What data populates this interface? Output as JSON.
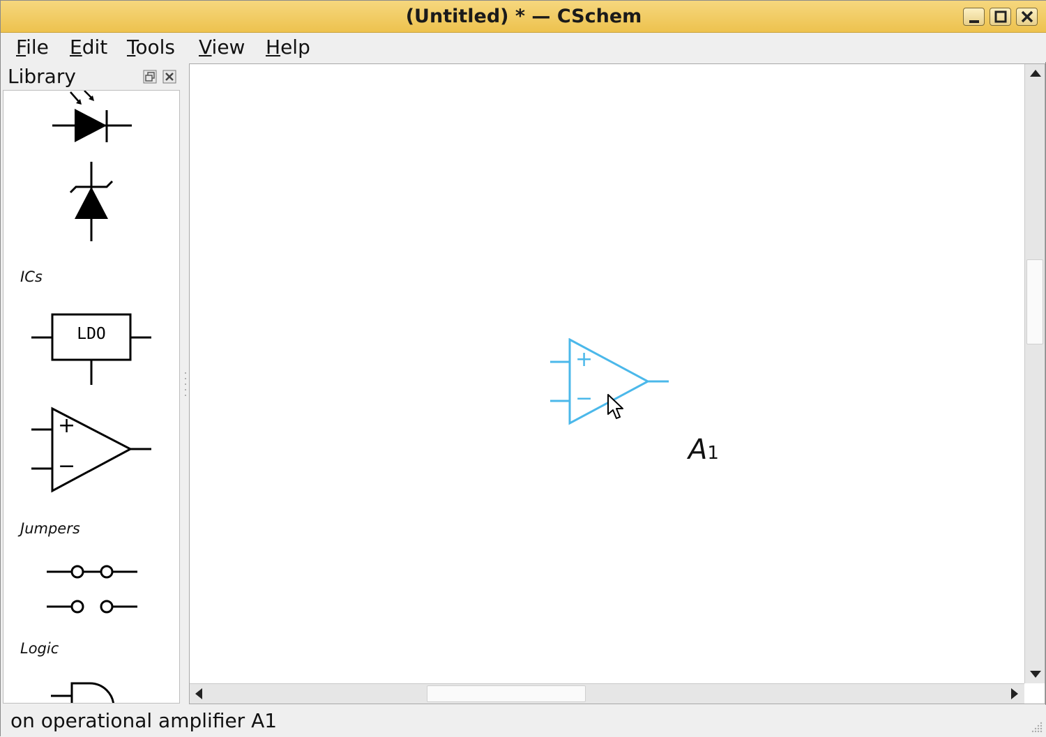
{
  "window": {
    "title": "(Untitled) * — CSchem"
  },
  "menu": [
    {
      "mnemonic": "F",
      "rest": "ile"
    },
    {
      "mnemonic": "E",
      "rest": "dit"
    },
    {
      "mnemonic": "T",
      "rest": "ools"
    },
    {
      "mnemonic": "V",
      "rest": "iew"
    },
    {
      "mnemonic": "H",
      "rest": "elp"
    }
  ],
  "library": {
    "title": "Library",
    "categories": [
      "ICs",
      "Jumpers",
      "Logic"
    ],
    "ldo_label": "LDO",
    "opamp_plus": "+",
    "opamp_minus": "−"
  },
  "canvas": {
    "selection_color": "#4bb8ea",
    "opamp_plus": "+",
    "opamp_minus": "−",
    "ref_letter": "A",
    "ref_number": "1"
  },
  "status": {
    "text": "on operational amplifier A1"
  },
  "icons": [
    "minimize-icon",
    "maximize-icon",
    "close-icon",
    "dock-float-icon",
    "dock-close-icon",
    "cursor-icon",
    "resize-grip-icon"
  ]
}
